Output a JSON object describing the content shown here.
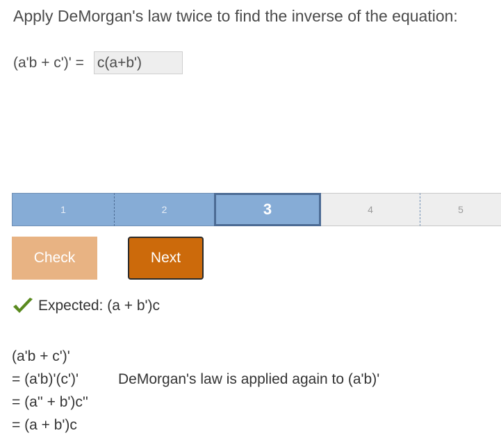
{
  "prompt": "Apply DeMorgan's law twice to find the inverse of the equation:",
  "question": {
    "lhs": "(a'b + c')' =",
    "answer_value": "c(a+b')"
  },
  "progress": {
    "steps": [
      "1",
      "2",
      "3",
      "4",
      "5"
    ],
    "current": 3
  },
  "buttons": {
    "check_label": "Check",
    "next_label": "Next"
  },
  "feedback": {
    "icon": "checkmark-icon",
    "text": "Expected: (a + b')c"
  },
  "solution": {
    "lines": [
      "(a'b + c')'",
      "= (a'b)'(c')'",
      "= (a'' + b')c''",
      "= (a + b')c"
    ],
    "note": "DeMorgan's law is applied again to (a'b)'"
  },
  "colors": {
    "step_done": "#86acd6",
    "step_current_border": "#4c6b94",
    "step_todo": "#eeeeee",
    "check_button": "#e8b383",
    "next_button": "#cc6a0b",
    "checkmark": "#5a8a1f"
  }
}
